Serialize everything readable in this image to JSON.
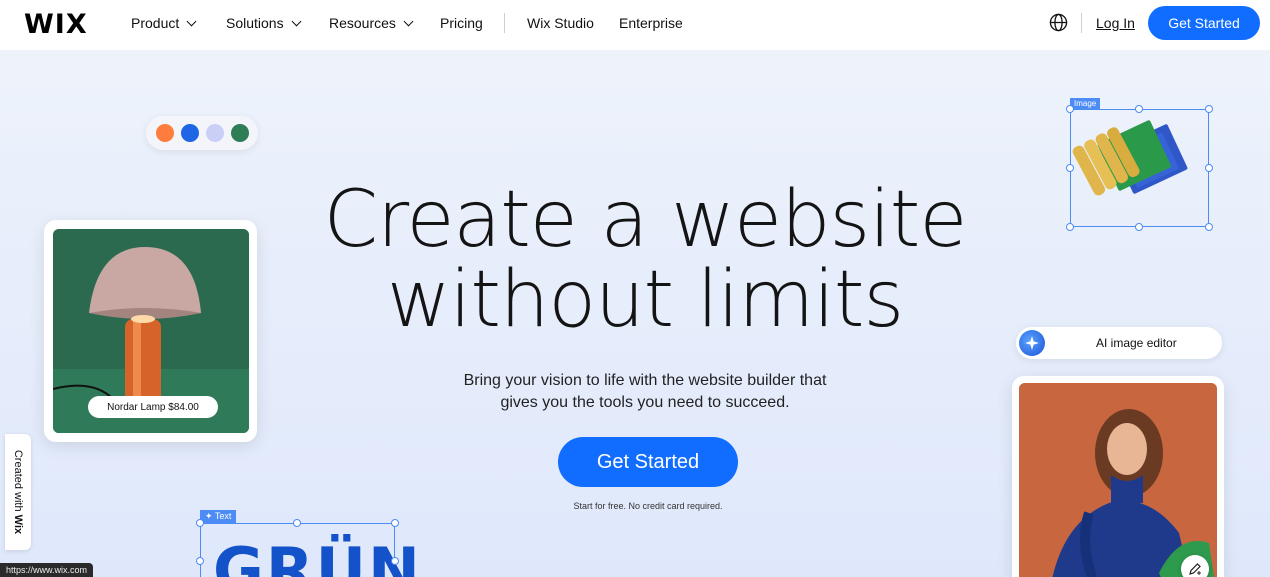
{
  "nav": {
    "logo": "WIX",
    "items": [
      {
        "label": "Product"
      },
      {
        "label": "Solutions"
      },
      {
        "label": "Resources"
      },
      {
        "label": "Pricing"
      },
      {
        "label": "Wix Studio"
      },
      {
        "label": "Enterprise"
      }
    ],
    "login": "Log In",
    "cta": "Get Started"
  },
  "hero": {
    "headline_line1": "Create a website",
    "headline_line2": "without limits",
    "sub_line1": "Bring your vision to life with the website builder that",
    "sub_line2": "gives you the tools you need to succeed.",
    "cta": "Get Started",
    "note": "Start for free. No credit card required."
  },
  "color_dots": [
    "#ff7d3c",
    "#1f66e6",
    "#c9cff7",
    "#2e7d57"
  ],
  "lamp_card": {
    "tag": "Nordar Lamp $84.00"
  },
  "image_selection": {
    "label": "Image"
  },
  "ai_editor": {
    "label": "AI image editor"
  },
  "text_selection": {
    "label": "Text",
    "word": "GRÜN"
  },
  "created_with": {
    "prefix": "Created with ",
    "brand": "Wix"
  },
  "status_url": "https://www.wix.com",
  "colors": {
    "accent": "#116dff",
    "selection": "#4d8bf5"
  }
}
